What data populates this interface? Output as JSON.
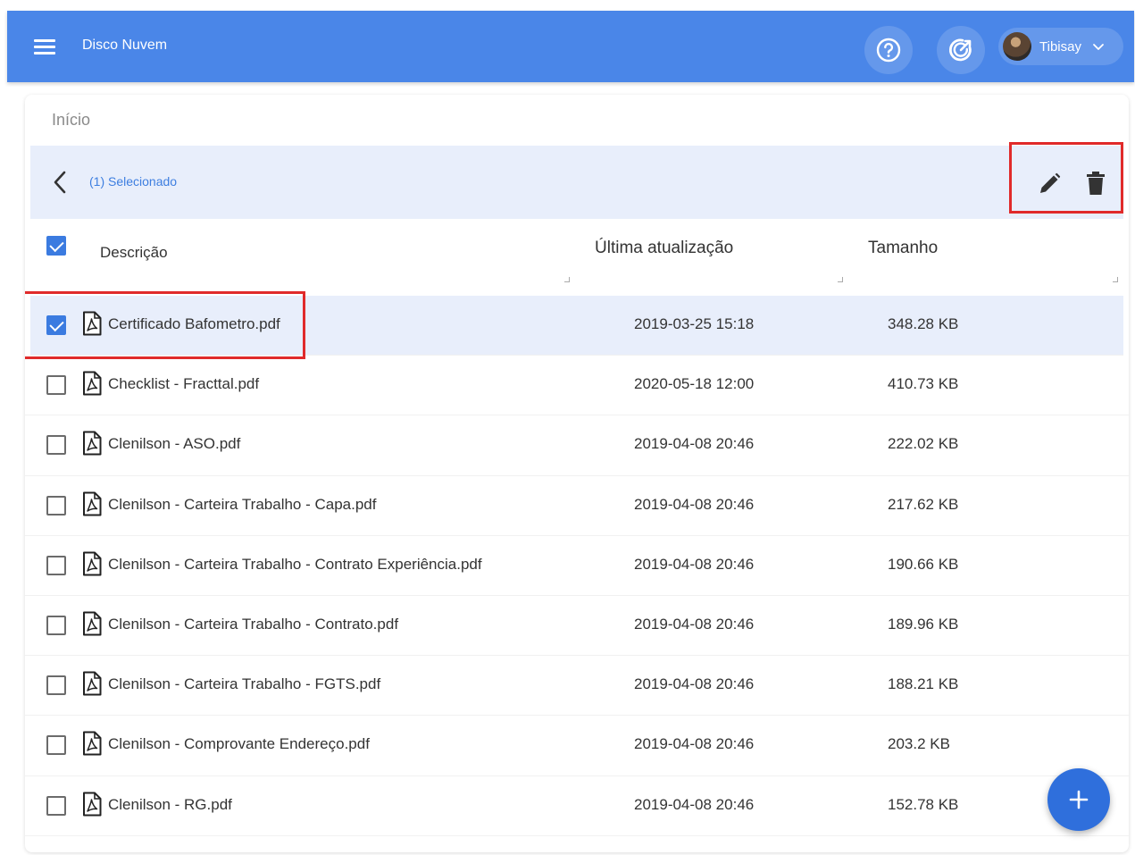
{
  "appbar": {
    "title": "Disco Nuvem",
    "user_name": "Tibisay",
    "icons": [
      "menu-icon",
      "help-icon",
      "sync-icon",
      "avatar",
      "chevron-down-icon"
    ]
  },
  "breadcrumb": "Início",
  "selection_bar": {
    "text": "(1) Selecionado",
    "icons": [
      "back-arrow-icon",
      "edit-pencil-icon",
      "trash-icon"
    ]
  },
  "table": {
    "columns": [
      "Descrição",
      "Última atualização",
      "Tamanho"
    ],
    "header_checked": true,
    "rows": [
      {
        "name": "Certificado Bafometro.pdf",
        "date": "2019-03-25 15:18",
        "size": "348.28 KB",
        "checked": true
      },
      {
        "name": "Checklist - Fracttal.pdf",
        "date": "2020-05-18 12:00",
        "size": "410.73 KB",
        "checked": false
      },
      {
        "name": "Clenilson - ASO.pdf",
        "date": "2019-04-08 20:46",
        "size": "222.02 KB",
        "checked": false
      },
      {
        "name": "Clenilson - Carteira Trabalho - Capa.pdf",
        "date": "2019-04-08 20:46",
        "size": "217.62 KB",
        "checked": false
      },
      {
        "name": "Clenilson - Carteira Trabalho - Contrato Experiência.pdf",
        "date": "2019-04-08 20:46",
        "size": "190.66 KB",
        "checked": false
      },
      {
        "name": "Clenilson - Carteira Trabalho - Contrato.pdf",
        "date": "2019-04-08 20:46",
        "size": "189.96 KB",
        "checked": false
      },
      {
        "name": "Clenilson - Carteira Trabalho - FGTS.pdf",
        "date": "2019-04-08 20:46",
        "size": "188.21 KB",
        "checked": false
      },
      {
        "name": "Clenilson - Comprovante Endereço.pdf",
        "date": "2019-04-08 20:46",
        "size": "203.2 KB",
        "checked": false
      },
      {
        "name": "Clenilson - RG.pdf",
        "date": "2019-04-08 20:46",
        "size": "152.78 KB",
        "checked": false
      }
    ]
  },
  "fab": {
    "icon": "plus-icon"
  },
  "colors": {
    "appbar": "#4a86e8",
    "accent": "#3b7be0",
    "selection_bg": "#e8eefb",
    "highlight_box": "#e02a2a"
  }
}
